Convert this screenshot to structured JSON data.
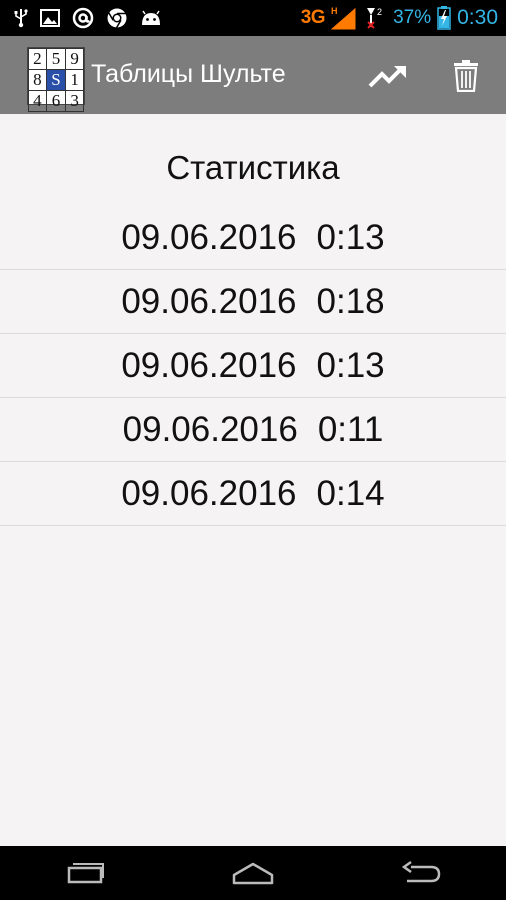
{
  "status_bar": {
    "network_label": "3G",
    "battery_percent": "37%",
    "time": "0:30",
    "left_icons": [
      "usb-icon",
      "image-icon",
      "at-icon",
      "chrome-icon",
      "android-icon"
    ]
  },
  "action_bar": {
    "app_icon_digits": [
      "2",
      "5",
      "9",
      "8",
      "S",
      "1",
      "4",
      "6",
      "3"
    ],
    "title": "Таблицы Шульте",
    "actions": [
      "trending-up-icon",
      "trash-icon"
    ]
  },
  "content": {
    "heading": "Статистика",
    "records": [
      {
        "date": "09.06.2016",
        "time": "0:13"
      },
      {
        "date": "09.06.2016",
        "time": "0:18"
      },
      {
        "date": "09.06.2016",
        "time": "0:13"
      },
      {
        "date": "09.06.2016",
        "time": "0:11"
      },
      {
        "date": "09.06.2016",
        "time": "0:14"
      }
    ]
  },
  "nav_bar": {
    "buttons": [
      "recent-apps-icon",
      "home-icon",
      "back-icon"
    ]
  },
  "colors": {
    "action_bar": "#7d7d7d",
    "status_accent": "#33b5e5",
    "network_accent": "#ff7a00",
    "background": "#f5f3f4"
  }
}
